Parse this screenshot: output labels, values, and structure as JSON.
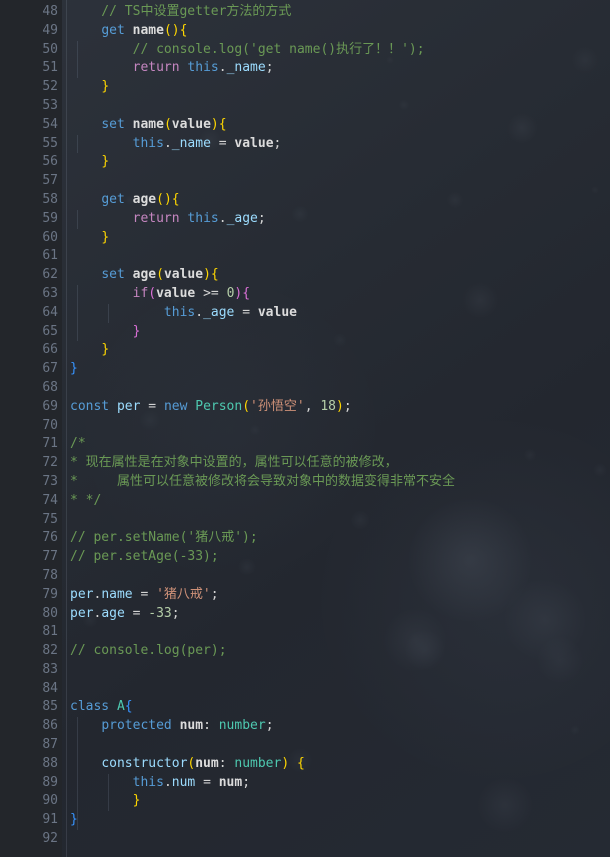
{
  "editor": {
    "language": "TypeScript",
    "first_line": 48,
    "last_line": 92,
    "theme_colors": {
      "background": "#262b33",
      "gutter": "#23262b",
      "line_number": "#6b7585",
      "comment": "#6a9955",
      "keyword": "#569cd6",
      "control": "#c586c0",
      "variable": "#9cdcfe",
      "string": "#ce9178",
      "number": "#b5cea8",
      "type": "#4ec9b0",
      "bracket_1": "#ffd700",
      "bracket_2": "#da70d6",
      "bracket_3": "#3794ff"
    }
  },
  "line_numbers": [
    "48",
    "49",
    "50",
    "51",
    "52",
    "53",
    "54",
    "55",
    "56",
    "57",
    "58",
    "59",
    "60",
    "61",
    "62",
    "63",
    "64",
    "65",
    "66",
    "67",
    "68",
    "69",
    "70",
    "71",
    "72",
    "73",
    "74",
    "75",
    "76",
    "77",
    "78",
    "79",
    "80",
    "81",
    "82",
    "83",
    "84",
    "85",
    "86",
    "87",
    "88",
    "89",
    "90",
    "91",
    "92"
  ],
  "code_lines": [
    {
      "n": "48",
      "indent": 1,
      "guides": [],
      "text": "    // TS中设置getter方法的方式"
    },
    {
      "n": "49",
      "indent": 1,
      "guides": [],
      "text": "    get name(){"
    },
    {
      "n": "50",
      "indent": 2,
      "guides": [
        "g1"
      ],
      "text": "        // console.log('get name()执行了！！');"
    },
    {
      "n": "51",
      "indent": 2,
      "guides": [
        "g1"
      ],
      "text": "        return this._name;"
    },
    {
      "n": "52",
      "indent": 1,
      "guides": [],
      "text": "    }"
    },
    {
      "n": "53",
      "indent": 0,
      "guides": [],
      "text": ""
    },
    {
      "n": "54",
      "indent": 1,
      "guides": [],
      "text": "    set name(value){"
    },
    {
      "n": "55",
      "indent": 2,
      "guides": [
        "g1"
      ],
      "text": "        this._name = value;"
    },
    {
      "n": "56",
      "indent": 1,
      "guides": [],
      "text": "    }"
    },
    {
      "n": "57",
      "indent": 0,
      "guides": [],
      "text": ""
    },
    {
      "n": "58",
      "indent": 1,
      "guides": [],
      "text": "    get age(){"
    },
    {
      "n": "59",
      "indent": 2,
      "guides": [
        "g1"
      ],
      "text": "        return this._age;"
    },
    {
      "n": "60",
      "indent": 1,
      "guides": [],
      "text": "    }"
    },
    {
      "n": "61",
      "indent": 0,
      "guides": [],
      "text": ""
    },
    {
      "n": "62",
      "indent": 1,
      "guides": [],
      "text": "    set age(value){"
    },
    {
      "n": "63",
      "indent": 2,
      "guides": [
        "g1"
      ],
      "text": "        if(value >= 0){"
    },
    {
      "n": "64",
      "indent": 3,
      "guides": [
        "g1",
        "g2"
      ],
      "text": "            this._age = value"
    },
    {
      "n": "65",
      "indent": 2,
      "guides": [
        "g1"
      ],
      "text": "        }"
    },
    {
      "n": "66",
      "indent": 1,
      "guides": [],
      "text": "    }"
    },
    {
      "n": "67",
      "indent": 0,
      "guides": [],
      "text": "}"
    },
    {
      "n": "68",
      "indent": 0,
      "guides": [],
      "text": ""
    },
    {
      "n": "69",
      "indent": 0,
      "guides": [],
      "text": "const per = new Person('孙悟空', 18);"
    },
    {
      "n": "70",
      "indent": 0,
      "guides": [],
      "text": ""
    },
    {
      "n": "71",
      "indent": 0,
      "guides": [],
      "text": "/*"
    },
    {
      "n": "72",
      "indent": 0,
      "guides": [],
      "text": "* 现在属性是在对象中设置的，属性可以任意的被修改，"
    },
    {
      "n": "73",
      "indent": 0,
      "guides": [],
      "text": "*     属性可以任意被修改将会导致对象中的数据变得非常不安全"
    },
    {
      "n": "74",
      "indent": 0,
      "guides": [],
      "text": "* */"
    },
    {
      "n": "75",
      "indent": 0,
      "guides": [],
      "text": ""
    },
    {
      "n": "76",
      "indent": 0,
      "guides": [],
      "text": "// per.setName('猪八戒');"
    },
    {
      "n": "77",
      "indent": 0,
      "guides": [],
      "text": "// per.setAge(-33);"
    },
    {
      "n": "78",
      "indent": 0,
      "guides": [],
      "text": ""
    },
    {
      "n": "79",
      "indent": 0,
      "guides": [],
      "text": "per.name = '猪八戒';"
    },
    {
      "n": "80",
      "indent": 0,
      "guides": [],
      "text": "per.age = -33;"
    },
    {
      "n": "81",
      "indent": 0,
      "guides": [],
      "text": ""
    },
    {
      "n": "82",
      "indent": 0,
      "guides": [],
      "text": "// console.log(per);"
    },
    {
      "n": "83",
      "indent": 0,
      "guides": [],
      "text": ""
    },
    {
      "n": "84",
      "indent": 0,
      "guides": [],
      "text": ""
    },
    {
      "n": "85",
      "indent": 0,
      "guides": [],
      "text": "class A{"
    },
    {
      "n": "86",
      "indent": 1,
      "guides": [
        "g1"
      ],
      "text": "    protected num: number;"
    },
    {
      "n": "87",
      "indent": 0,
      "guides": [
        "g1"
      ],
      "text": ""
    },
    {
      "n": "88",
      "indent": 1,
      "guides": [
        "g1"
      ],
      "text": "    constructor(num: number) {"
    },
    {
      "n": "89",
      "indent": 2,
      "guides": [
        "g1",
        "g2"
      ],
      "text": "        this.num = num;"
    },
    {
      "n": "90",
      "indent": 1,
      "guides": [
        "g1",
        "g2"
      ],
      "text": "        }"
    },
    {
      "n": "91",
      "indent": 0,
      "guides": [
        "g1"
      ],
      "text": "}"
    },
    {
      "n": "92",
      "indent": 0,
      "guides": [],
      "text": ""
    }
  ],
  "tokens": {
    "l48": [
      {
        "t": "    // TS中设置getter方法的方式",
        "c": "cm"
      }
    ],
    "l49": [
      {
        "t": "    ",
        "c": "pn"
      },
      {
        "t": "get",
        "c": "kw"
      },
      {
        "t": " ",
        "c": "pn"
      },
      {
        "t": "name",
        "c": "fn"
      },
      {
        "t": "(",
        "c": "b1"
      },
      {
        "t": ")",
        "c": "b1"
      },
      {
        "t": "{",
        "c": "b1"
      }
    ],
    "l50": [
      {
        "t": "        // console.log('get name()执行了！！');",
        "c": "cm"
      }
    ],
    "l51": [
      {
        "t": "        ",
        "c": "pn"
      },
      {
        "t": "return",
        "c": "ctl"
      },
      {
        "t": " ",
        "c": "pn"
      },
      {
        "t": "this",
        "c": "kw"
      },
      {
        "t": ".",
        "c": "pn"
      },
      {
        "t": "_name",
        "c": "prop"
      },
      {
        "t": ";",
        "c": "pn"
      }
    ],
    "l52": [
      {
        "t": "    ",
        "c": "pn"
      },
      {
        "t": "}",
        "c": "b1"
      }
    ],
    "l54": [
      {
        "t": "    ",
        "c": "pn"
      },
      {
        "t": "set",
        "c": "kw"
      },
      {
        "t": " ",
        "c": "pn"
      },
      {
        "t": "name",
        "c": "fn"
      },
      {
        "t": "(",
        "c": "b1"
      },
      {
        "t": "value",
        "c": "fn"
      },
      {
        "t": ")",
        "c": "b1"
      },
      {
        "t": "{",
        "c": "b1"
      }
    ],
    "l55": [
      {
        "t": "        ",
        "c": "pn"
      },
      {
        "t": "this",
        "c": "kw"
      },
      {
        "t": ".",
        "c": "pn"
      },
      {
        "t": "_name",
        "c": "prop"
      },
      {
        "t": " = ",
        "c": "op"
      },
      {
        "t": "value",
        "c": "fn"
      },
      {
        "t": ";",
        "c": "pn"
      }
    ],
    "l56": [
      {
        "t": "    ",
        "c": "pn"
      },
      {
        "t": "}",
        "c": "b1"
      }
    ],
    "l58": [
      {
        "t": "    ",
        "c": "pn"
      },
      {
        "t": "get",
        "c": "kw"
      },
      {
        "t": " ",
        "c": "pn"
      },
      {
        "t": "age",
        "c": "fn"
      },
      {
        "t": "(",
        "c": "b1"
      },
      {
        "t": ")",
        "c": "b1"
      },
      {
        "t": "{",
        "c": "b1"
      }
    ],
    "l59": [
      {
        "t": "        ",
        "c": "pn"
      },
      {
        "t": "return",
        "c": "ctl"
      },
      {
        "t": " ",
        "c": "pn"
      },
      {
        "t": "this",
        "c": "kw"
      },
      {
        "t": ".",
        "c": "pn"
      },
      {
        "t": "_age",
        "c": "prop"
      },
      {
        "t": ";",
        "c": "pn"
      }
    ],
    "l60": [
      {
        "t": "    ",
        "c": "pn"
      },
      {
        "t": "}",
        "c": "b1"
      }
    ],
    "l62": [
      {
        "t": "    ",
        "c": "pn"
      },
      {
        "t": "set",
        "c": "kw"
      },
      {
        "t": " ",
        "c": "pn"
      },
      {
        "t": "age",
        "c": "fn"
      },
      {
        "t": "(",
        "c": "b1"
      },
      {
        "t": "value",
        "c": "fn"
      },
      {
        "t": ")",
        "c": "b1"
      },
      {
        "t": "{",
        "c": "b1"
      }
    ],
    "l63": [
      {
        "t": "        ",
        "c": "pn"
      },
      {
        "t": "if",
        "c": "ctl"
      },
      {
        "t": "(",
        "c": "b2"
      },
      {
        "t": "value",
        "c": "fn"
      },
      {
        "t": " >= ",
        "c": "op"
      },
      {
        "t": "0",
        "c": "num"
      },
      {
        "t": ")",
        "c": "b2"
      },
      {
        "t": "{",
        "c": "b2"
      }
    ],
    "l64": [
      {
        "t": "            ",
        "c": "pn"
      },
      {
        "t": "this",
        "c": "kw"
      },
      {
        "t": ".",
        "c": "pn"
      },
      {
        "t": "_age",
        "c": "prop"
      },
      {
        "t": " = ",
        "c": "op"
      },
      {
        "t": "value",
        "c": "fn"
      }
    ],
    "l65": [
      {
        "t": "        ",
        "c": "pn"
      },
      {
        "t": "}",
        "c": "b2"
      }
    ],
    "l66": [
      {
        "t": "    ",
        "c": "pn"
      },
      {
        "t": "}",
        "c": "b1"
      }
    ],
    "l67": [
      {
        "t": "}",
        "c": "b3"
      }
    ],
    "l69": [
      {
        "t": "const",
        "c": "kw"
      },
      {
        "t": " ",
        "c": "pn"
      },
      {
        "t": "per",
        "c": "var"
      },
      {
        "t": " = ",
        "c": "op"
      },
      {
        "t": "new",
        "c": "kw"
      },
      {
        "t": " ",
        "c": "pn"
      },
      {
        "t": "Person",
        "c": "typ"
      },
      {
        "t": "(",
        "c": "b1"
      },
      {
        "t": "'孙悟空'",
        "c": "str"
      },
      {
        "t": ", ",
        "c": "pn"
      },
      {
        "t": "18",
        "c": "num"
      },
      {
        "t": ")",
        "c": "b1"
      },
      {
        "t": ";",
        "c": "pn"
      }
    ],
    "l71": [
      {
        "t": "/*",
        "c": "cm"
      }
    ],
    "l72": [
      {
        "t": "* 现在属性是在对象中设置的，属性可以任意的被修改，",
        "c": "cm"
      }
    ],
    "l73": [
      {
        "t": "*     属性可以任意被修改将会导致对象中的数据变得非常不安全",
        "c": "cm"
      }
    ],
    "l74": [
      {
        "t": "* */",
        "c": "cm"
      }
    ],
    "l76": [
      {
        "t": "// per.setName('猪八戒');",
        "c": "cm"
      }
    ],
    "l77": [
      {
        "t": "// per.setAge(-33);",
        "c": "cm"
      }
    ],
    "l79": [
      {
        "t": "per",
        "c": "var"
      },
      {
        "t": ".",
        "c": "pn"
      },
      {
        "t": "name",
        "c": "prop"
      },
      {
        "t": " = ",
        "c": "op"
      },
      {
        "t": "'猪八戒'",
        "c": "str"
      },
      {
        "t": ";",
        "c": "pn"
      }
    ],
    "l80": [
      {
        "t": "per",
        "c": "var"
      },
      {
        "t": ".",
        "c": "pn"
      },
      {
        "t": "age",
        "c": "prop"
      },
      {
        "t": " = ",
        "c": "op"
      },
      {
        "t": "-33",
        "c": "num"
      },
      {
        "t": ";",
        "c": "pn"
      }
    ],
    "l82": [
      {
        "t": "// console.log(per);",
        "c": "cm"
      }
    ],
    "l85": [
      {
        "t": "class",
        "c": "kw"
      },
      {
        "t": " ",
        "c": "pn"
      },
      {
        "t": "A",
        "c": "typ"
      },
      {
        "t": "{",
        "c": "b3"
      }
    ],
    "l86": [
      {
        "t": "    ",
        "c": "pn"
      },
      {
        "t": "protected",
        "c": "kw"
      },
      {
        "t": " ",
        "c": "pn"
      },
      {
        "t": "num",
        "c": "fn"
      },
      {
        "t": ": ",
        "c": "pn"
      },
      {
        "t": "number",
        "c": "typ"
      },
      {
        "t": ";",
        "c": "pn"
      }
    ],
    "l88": [
      {
        "t": "    ",
        "c": "pn"
      },
      {
        "t": "constructor",
        "c": "var"
      },
      {
        "t": "(",
        "c": "b1"
      },
      {
        "t": "num",
        "c": "fn"
      },
      {
        "t": ": ",
        "c": "pn"
      },
      {
        "t": "number",
        "c": "typ"
      },
      {
        "t": ")",
        "c": "b1"
      },
      {
        "t": " ",
        "c": "pn"
      },
      {
        "t": "{",
        "c": "b1"
      }
    ],
    "l89": [
      {
        "t": "        ",
        "c": "pn"
      },
      {
        "t": "this",
        "c": "kw"
      },
      {
        "t": ".",
        "c": "pn"
      },
      {
        "t": "num",
        "c": "prop"
      },
      {
        "t": " = ",
        "c": "op"
      },
      {
        "t": "num",
        "c": "fn"
      },
      {
        "t": ";",
        "c": "pn"
      }
    ],
    "l90": [
      {
        "t": "        ",
        "c": "pn"
      },
      {
        "t": "}",
        "c": "b1"
      }
    ],
    "l91": [
      {
        "t": "}",
        "c": "b3"
      }
    ]
  }
}
